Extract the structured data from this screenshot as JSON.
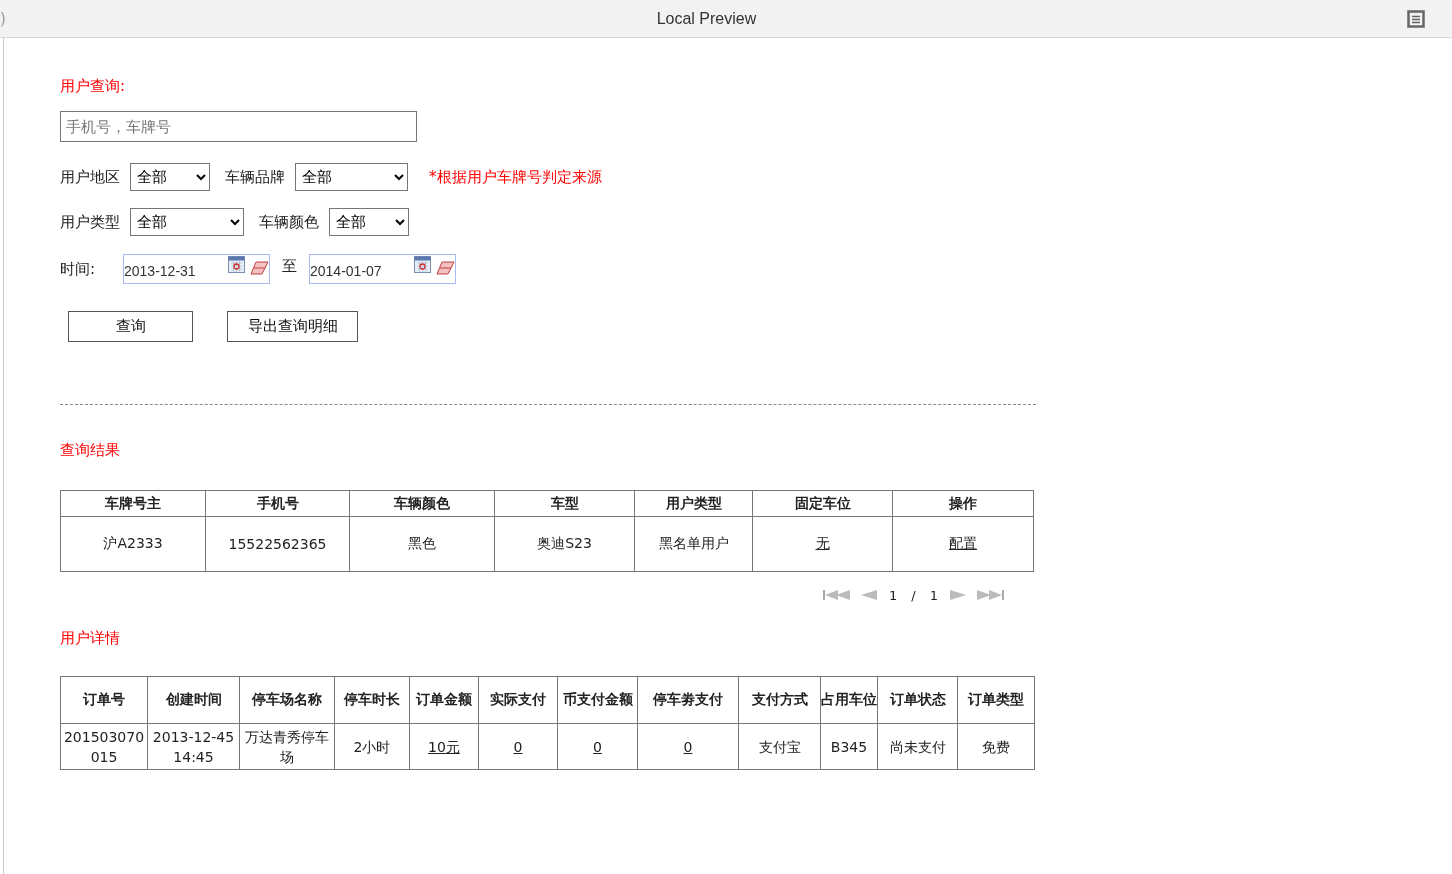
{
  "window": {
    "title": "Local Preview",
    "edge_text": ")"
  },
  "query": {
    "heading": "用户查询:",
    "search": {
      "placeholder": "手机号，车牌号"
    },
    "filter_rows": [
      {
        "filters": [
          {
            "label": "用户地区",
            "value": "全部"
          },
          {
            "label": "车辆品牌",
            "value": "全部"
          }
        ],
        "note": "*根据用户车牌号判定来源"
      },
      {
        "filters": [
          {
            "label": "用户类型",
            "value": "全部"
          },
          {
            "label": "车辆颜色",
            "value": "全部"
          }
        ]
      }
    ],
    "time": {
      "label": "时间:",
      "from": "2013-12-31",
      "separator": "至",
      "to": "2014-01-07"
    },
    "buttons": [
      {
        "label": "查询"
      },
      {
        "label": "导出查询明细"
      }
    ]
  },
  "results": {
    "heading": "查询结果",
    "columns": [
      "车牌号主",
      "手机号",
      "车辆颜色",
      "车型",
      "用户类型",
      "固定车位",
      "操作"
    ],
    "rows": [
      [
        {
          "text": "沪A2333",
          "link": false
        },
        {
          "text": "15522562365",
          "link": false
        },
        {
          "text": "黑色",
          "link": false
        },
        {
          "text": "奥迪S23",
          "link": false
        },
        {
          "text": "黑名单用户",
          "link": false
        },
        {
          "text": "无",
          "link": true
        },
        {
          "text": "配置",
          "link": true
        }
      ]
    ],
    "pager": {
      "page": "1",
      "separator": "/",
      "total": "1"
    }
  },
  "details": {
    "heading": "用户详情",
    "columns": [
      "订单号",
      "创建时间",
      "停车场名称",
      "停车时长",
      "订单金额",
      "实际支付",
      "币支付金额",
      "停车劵支付",
      "支付方式",
      "占用车位",
      "订单状态",
      "订单类型"
    ],
    "rows": [
      [
        {
          "text": "201503070015",
          "link": false
        },
        {
          "text": "2013-12-45 14:45",
          "link": false
        },
        {
          "text": "万达青秀停车场",
          "link": false
        },
        {
          "text": "2小时",
          "link": false
        },
        {
          "text": "10元",
          "link": true
        },
        {
          "text": "0",
          "link": true
        },
        {
          "text": "0",
          "link": true
        },
        {
          "text": "0",
          "link": true
        },
        {
          "text": "支付宝",
          "link": false
        },
        {
          "text": "B345",
          "link": false
        },
        {
          "text": "尚未支付",
          "link": false
        },
        {
          "text": "免费",
          "link": false
        }
      ]
    ]
  }
}
